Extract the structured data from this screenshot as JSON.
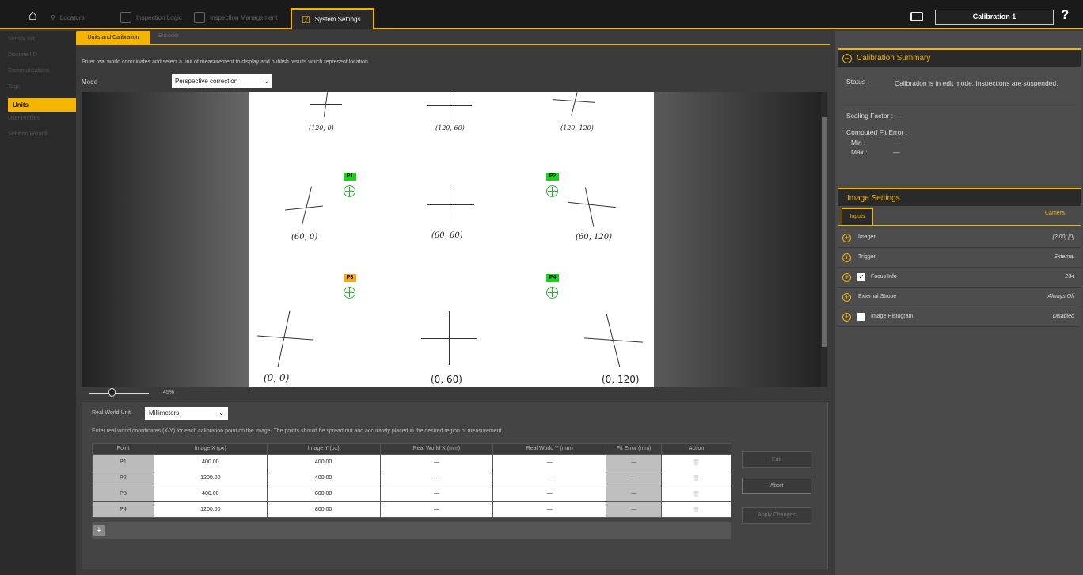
{
  "nav": {
    "items": [
      {
        "label": "Locators"
      },
      {
        "label": "Inspection Logic"
      },
      {
        "label": "Inspection Management"
      }
    ],
    "active": "System Settings",
    "calibration": "Calibration 1",
    "help": "?"
  },
  "sidebar": {
    "items": [
      "Sensor Info",
      "Discrete I/O",
      "Communications",
      "Tags",
      "Units",
      "User Profiles",
      "Solution Wizard"
    ]
  },
  "subtabs": {
    "active": "Units and Calibration",
    "other": "Encoder"
  },
  "main": {
    "description": "Enter real world coordinates and select a unit of measurement to display and publish results which represent location.",
    "mode_label": "Mode",
    "mode_value": "Perspective correction",
    "zoom": "45%"
  },
  "image": {
    "coords": [
      "(120, 0)",
      "(120, 60)",
      "(120, 120)",
      "(60, 0)",
      "(60, 60)",
      "(60, 120)",
      "(0, 0)",
      "(0, 60)",
      "(0, 120)"
    ],
    "points": [
      "P1",
      "P2",
      "P3",
      "P4"
    ]
  },
  "calibration": {
    "unit_label": "Real World Unit",
    "unit_value": "Millimeters",
    "instructions": "Enter real world coordinates (X/Y) for each calibration point on the image. The points should be spread out and accurately placed in the desired region of measurement.",
    "columns": [
      "Point",
      "Image X (px)",
      "Image Y (px)",
      "Real World X (mm)",
      "Real World Y (mm)",
      "Fit Error (mm)",
      "Action"
    ],
    "rows": [
      {
        "point": "P1",
        "x": "400.00",
        "y": "400.00",
        "rx": "—",
        "ry": "—",
        "fit": "—"
      },
      {
        "point": "P2",
        "x": "1200.00",
        "y": "400.00",
        "rx": "—",
        "ry": "—",
        "fit": "—"
      },
      {
        "point": "P3",
        "x": "400.00",
        "y": "800.00",
        "rx": "—",
        "ry": "—",
        "fit": "—"
      },
      {
        "point": "P4",
        "x": "1200.00",
        "y": "800.00",
        "rx": "—",
        "ry": "—",
        "fit": "—"
      }
    ],
    "buttons": {
      "edit": "Edit",
      "abort": "Abort",
      "apply": "Apply Changes"
    }
  },
  "summary": {
    "title": "Calibration Summary",
    "status_label": "Status :",
    "status_text": "Calibration is in edit mode. Inspections are suspended.",
    "scaling": "Scaling Factor : —",
    "fit_error": "Computed Fit Error :",
    "min": "Min :",
    "max": "Max :",
    "dash": "—"
  },
  "image_settings": {
    "title": "Image Settings",
    "tab_inputs": "Inputs",
    "tab_camera": "Camera",
    "rows": [
      {
        "label": "Imager",
        "value": "[2.00] [0]"
      },
      {
        "label": "Trigger",
        "value": "External"
      },
      {
        "label": "Focus Info",
        "value": "234"
      },
      {
        "label": "External Strobe",
        "value": "Always Off"
      },
      {
        "label": "Image Histogram",
        "value": "Disabled"
      }
    ]
  }
}
